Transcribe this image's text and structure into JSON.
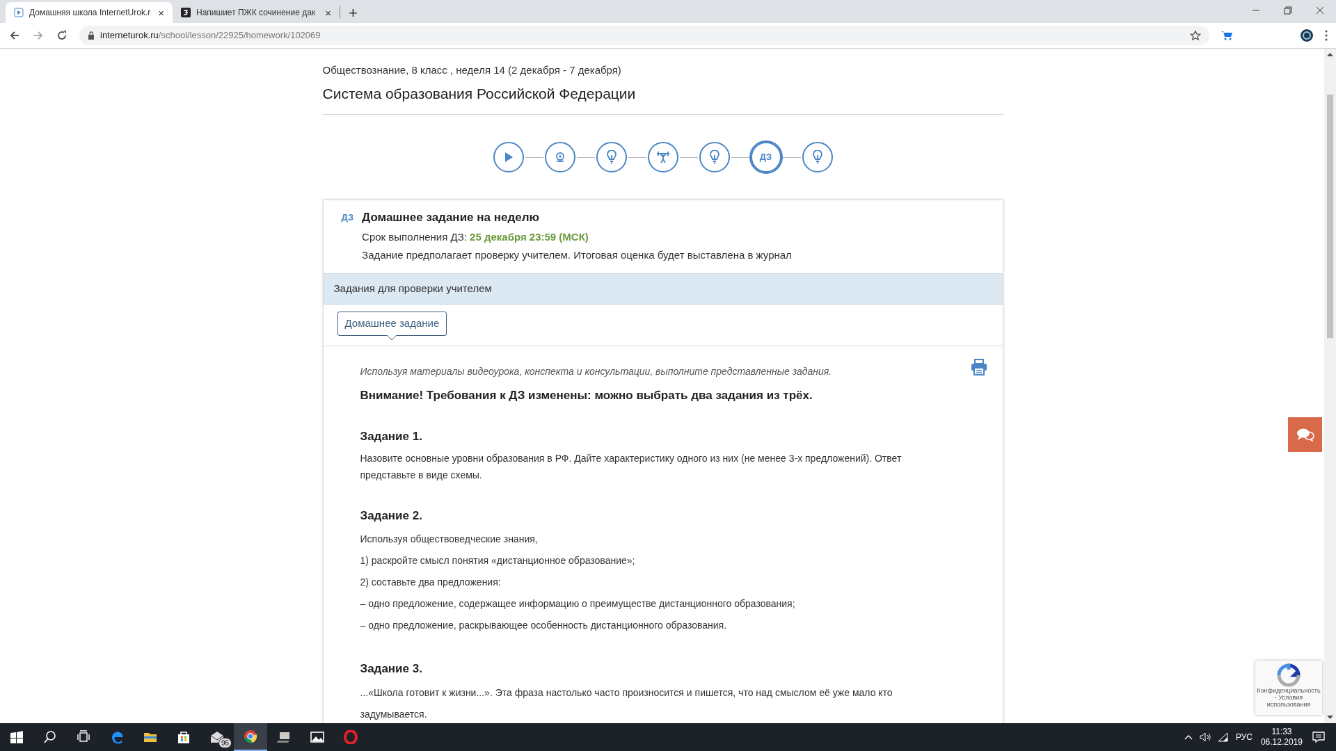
{
  "browser": {
    "tabs": [
      {
        "title": "Домашняя школа InternetUrok.r",
        "close": "×",
        "selected": true
      },
      {
        "title": "Напишиет ПЖК сочинение дак",
        "close": "×",
        "selected": false
      }
    ],
    "new_tab": "+",
    "url_host": "interneturok.ru",
    "url_path": "/school/lesson/22925/homework/102069"
  },
  "page": {
    "breadcrumb": "Обществознание, 8 класс , неделя 14 (2 декабря - 7 декабря)",
    "title": "Система образования Российской Федерации",
    "steps": [
      {
        "kind": "play",
        "selected": false
      },
      {
        "kind": "webcam",
        "selected": false
      },
      {
        "kind": "bulb",
        "selected": false
      },
      {
        "kind": "weights",
        "selected": false
      },
      {
        "kind": "bulb",
        "selected": false
      },
      {
        "kind": "text",
        "label": "ДЗ",
        "selected": true
      },
      {
        "kind": "bulb",
        "selected": false
      }
    ],
    "card": {
      "badge": "ДЗ",
      "title": "Домашнее задание на неделю",
      "deadline_label": "Срок выполнения ДЗ:",
      "deadline": "25 декабря 23:59 (МСК)",
      "note": "Задание предполагает проверку учителем. Итоговая оценка будет выставлена в журнал",
      "band": "Задания для проверки учителем",
      "tabs": [
        {
          "label": "Домашнее задание",
          "selected": true
        }
      ],
      "blocks": [
        {
          "kind": "intro",
          "text": "Используя материалы видеоурока, конспекта и консультации, выполните представленные задания."
        },
        {
          "kind": "notice",
          "text": "Внимание! Требования к ДЗ изменены: можно выбрать два задания из трёх."
        },
        {
          "kind": "heading",
          "text": "Задание 1."
        },
        {
          "kind": "paragraph",
          "text": "Назовите основные уровни образования в РФ. Дайте характеристику одного из них (не менее 3-х предложений). Ответ представьте в виде схемы."
        },
        {
          "kind": "heading",
          "text": "Задание 2."
        },
        {
          "kind": "line",
          "text": "Используя обществоведческие знания,"
        },
        {
          "kind": "line",
          "text": "1) раскройте смысл понятия «дистанционное образование»;"
        },
        {
          "kind": "line",
          "text": "2) составьте два предложения:"
        },
        {
          "kind": "line",
          "text": "– одно предложение, содержащее информацию о преимуществе дистанционного образования;"
        },
        {
          "kind": "line",
          "text": "– одно предложение, раскрывающее особенность дистанционного образования."
        },
        {
          "kind": "heading",
          "text": "Задание 3."
        },
        {
          "kind": "line",
          "text": "...«Школа готовит к жизни...». Эта фраза настолько часто произносится и пишется, что над смыслом её уже мало кто задумывается."
        }
      ]
    },
    "recaptcha": "Конфиденциальность - Условия использования"
  },
  "taskbar": {
    "mail_badge": "96",
    "language": "РУС",
    "time": "11:33",
    "date": "06.12.2019"
  }
}
